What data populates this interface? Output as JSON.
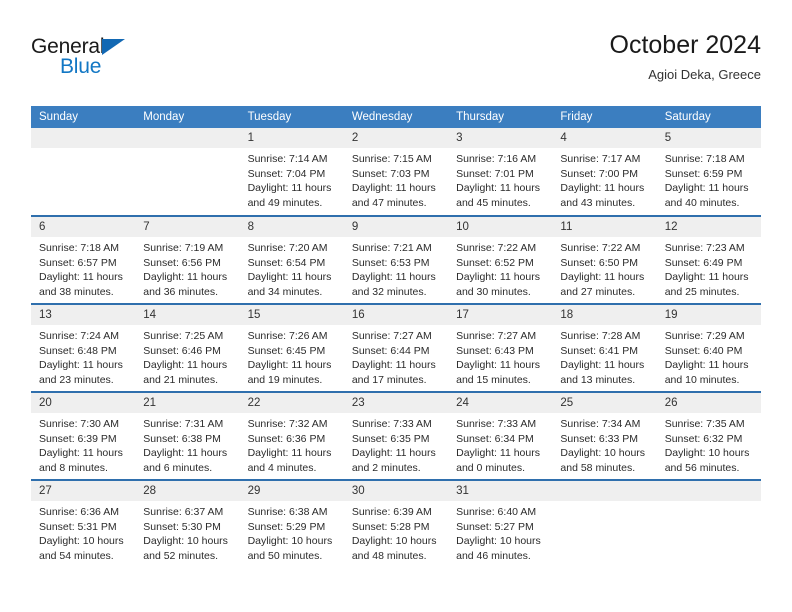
{
  "brand": {
    "name_part1": "General",
    "name_part2": "Blue",
    "triangle_color": "#1268b3",
    "blue_color": "#1277c4"
  },
  "header": {
    "title": "October 2024",
    "subtitle": "Agioi Deka, Greece"
  },
  "theme": {
    "header_bg": "#3b7ec0",
    "row_divider": "#2f6fad",
    "daynum_bg": "#efefef",
    "text": "#2b2b2b"
  },
  "weekdays": [
    "Sunday",
    "Monday",
    "Tuesday",
    "Wednesday",
    "Thursday",
    "Friday",
    "Saturday"
  ],
  "labels": {
    "sunrise_prefix": "Sunrise: ",
    "sunset_prefix": "Sunset: ",
    "daylight_prefix": "Daylight: "
  },
  "weeks": [
    [
      {
        "day": "",
        "lines": []
      },
      {
        "day": "",
        "lines": []
      },
      {
        "day": "1",
        "lines": [
          "Sunrise: 7:14 AM",
          "Sunset: 7:04 PM",
          "Daylight: 11 hours and 49 minutes."
        ]
      },
      {
        "day": "2",
        "lines": [
          "Sunrise: 7:15 AM",
          "Sunset: 7:03 PM",
          "Daylight: 11 hours and 47 minutes."
        ]
      },
      {
        "day": "3",
        "lines": [
          "Sunrise: 7:16 AM",
          "Sunset: 7:01 PM",
          "Daylight: 11 hours and 45 minutes."
        ]
      },
      {
        "day": "4",
        "lines": [
          "Sunrise: 7:17 AM",
          "Sunset: 7:00 PM",
          "Daylight: 11 hours and 43 minutes."
        ]
      },
      {
        "day": "5",
        "lines": [
          "Sunrise: 7:18 AM",
          "Sunset: 6:59 PM",
          "Daylight: 11 hours and 40 minutes."
        ]
      }
    ],
    [
      {
        "day": "6",
        "lines": [
          "Sunrise: 7:18 AM",
          "Sunset: 6:57 PM",
          "Daylight: 11 hours and 38 minutes."
        ]
      },
      {
        "day": "7",
        "lines": [
          "Sunrise: 7:19 AM",
          "Sunset: 6:56 PM",
          "Daylight: 11 hours and 36 minutes."
        ]
      },
      {
        "day": "8",
        "lines": [
          "Sunrise: 7:20 AM",
          "Sunset: 6:54 PM",
          "Daylight: 11 hours and 34 minutes."
        ]
      },
      {
        "day": "9",
        "lines": [
          "Sunrise: 7:21 AM",
          "Sunset: 6:53 PM",
          "Daylight: 11 hours and 32 minutes."
        ]
      },
      {
        "day": "10",
        "lines": [
          "Sunrise: 7:22 AM",
          "Sunset: 6:52 PM",
          "Daylight: 11 hours and 30 minutes."
        ]
      },
      {
        "day": "11",
        "lines": [
          "Sunrise: 7:22 AM",
          "Sunset: 6:50 PM",
          "Daylight: 11 hours and 27 minutes."
        ]
      },
      {
        "day": "12",
        "lines": [
          "Sunrise: 7:23 AM",
          "Sunset: 6:49 PM",
          "Daylight: 11 hours and 25 minutes."
        ]
      }
    ],
    [
      {
        "day": "13",
        "lines": [
          "Sunrise: 7:24 AM",
          "Sunset: 6:48 PM",
          "Daylight: 11 hours and 23 minutes."
        ]
      },
      {
        "day": "14",
        "lines": [
          "Sunrise: 7:25 AM",
          "Sunset: 6:46 PM",
          "Daylight: 11 hours and 21 minutes."
        ]
      },
      {
        "day": "15",
        "lines": [
          "Sunrise: 7:26 AM",
          "Sunset: 6:45 PM",
          "Daylight: 11 hours and 19 minutes."
        ]
      },
      {
        "day": "16",
        "lines": [
          "Sunrise: 7:27 AM",
          "Sunset: 6:44 PM",
          "Daylight: 11 hours and 17 minutes."
        ]
      },
      {
        "day": "17",
        "lines": [
          "Sunrise: 7:27 AM",
          "Sunset: 6:43 PM",
          "Daylight: 11 hours and 15 minutes."
        ]
      },
      {
        "day": "18",
        "lines": [
          "Sunrise: 7:28 AM",
          "Sunset: 6:41 PM",
          "Daylight: 11 hours and 13 minutes."
        ]
      },
      {
        "day": "19",
        "lines": [
          "Sunrise: 7:29 AM",
          "Sunset: 6:40 PM",
          "Daylight: 11 hours and 10 minutes."
        ]
      }
    ],
    [
      {
        "day": "20",
        "lines": [
          "Sunrise: 7:30 AM",
          "Sunset: 6:39 PM",
          "Daylight: 11 hours and 8 minutes."
        ]
      },
      {
        "day": "21",
        "lines": [
          "Sunrise: 7:31 AM",
          "Sunset: 6:38 PM",
          "Daylight: 11 hours and 6 minutes."
        ]
      },
      {
        "day": "22",
        "lines": [
          "Sunrise: 7:32 AM",
          "Sunset: 6:36 PM",
          "Daylight: 11 hours and 4 minutes."
        ]
      },
      {
        "day": "23",
        "lines": [
          "Sunrise: 7:33 AM",
          "Sunset: 6:35 PM",
          "Daylight: 11 hours and 2 minutes."
        ]
      },
      {
        "day": "24",
        "lines": [
          "Sunrise: 7:33 AM",
          "Sunset: 6:34 PM",
          "Daylight: 11 hours and 0 minutes."
        ]
      },
      {
        "day": "25",
        "lines": [
          "Sunrise: 7:34 AM",
          "Sunset: 6:33 PM",
          "Daylight: 10 hours and 58 minutes."
        ]
      },
      {
        "day": "26",
        "lines": [
          "Sunrise: 7:35 AM",
          "Sunset: 6:32 PM",
          "Daylight: 10 hours and 56 minutes."
        ]
      }
    ],
    [
      {
        "day": "27",
        "lines": [
          "Sunrise: 6:36 AM",
          "Sunset: 5:31 PM",
          "Daylight: 10 hours and 54 minutes."
        ]
      },
      {
        "day": "28",
        "lines": [
          "Sunrise: 6:37 AM",
          "Sunset: 5:30 PM",
          "Daylight: 10 hours and 52 minutes."
        ]
      },
      {
        "day": "29",
        "lines": [
          "Sunrise: 6:38 AM",
          "Sunset: 5:29 PM",
          "Daylight: 10 hours and 50 minutes."
        ]
      },
      {
        "day": "30",
        "lines": [
          "Sunrise: 6:39 AM",
          "Sunset: 5:28 PM",
          "Daylight: 10 hours and 48 minutes."
        ]
      },
      {
        "day": "31",
        "lines": [
          "Sunrise: 6:40 AM",
          "Sunset: 5:27 PM",
          "Daylight: 10 hours and 46 minutes."
        ]
      },
      {
        "day": "",
        "lines": []
      },
      {
        "day": "",
        "lines": []
      }
    ]
  ]
}
